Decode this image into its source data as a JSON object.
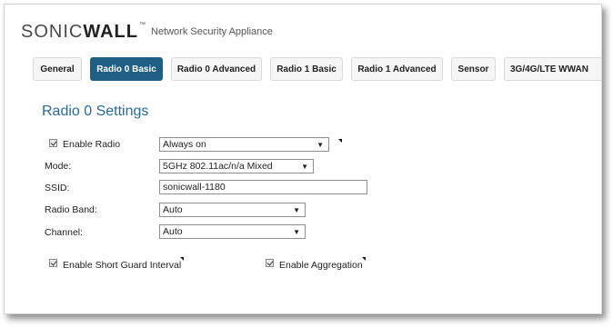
{
  "header": {
    "logo_regular": "SONIC",
    "logo_bold": "WALL",
    "logo_mark": "™",
    "product": "Network Security Appliance"
  },
  "tabs": [
    {
      "label": "General",
      "active": false
    },
    {
      "label": "Radio 0 Basic",
      "active": true
    },
    {
      "label": "Radio 0 Advanced",
      "active": false
    },
    {
      "label": "Radio 1 Basic",
      "active": false
    },
    {
      "label": "Radio 1 Advanced",
      "active": false
    },
    {
      "label": "Sensor",
      "active": false
    },
    {
      "label": "3G/4G/LTE WWAN",
      "active": false
    }
  ],
  "settings": {
    "title": "Radio 0 Settings",
    "enable_radio_label": "Enable Radio",
    "enable_radio_checked": true,
    "enable_radio_value": "Always on",
    "mode_label": "Mode:",
    "mode_value": "5GHz 802.11ac/n/a Mixed",
    "ssid_label": "SSID:",
    "ssid_value": "sonicwall-1180",
    "band_label": "Radio Band:",
    "band_value": "Auto",
    "channel_label": "Channel:",
    "channel_value": "Auto",
    "short_guard_label": "Enable Short Guard Interval",
    "short_guard_checked": true,
    "aggregation_label": "Enable Aggregation",
    "aggregation_checked": true
  },
  "icons": {
    "dropdown_arrow": "▼"
  }
}
